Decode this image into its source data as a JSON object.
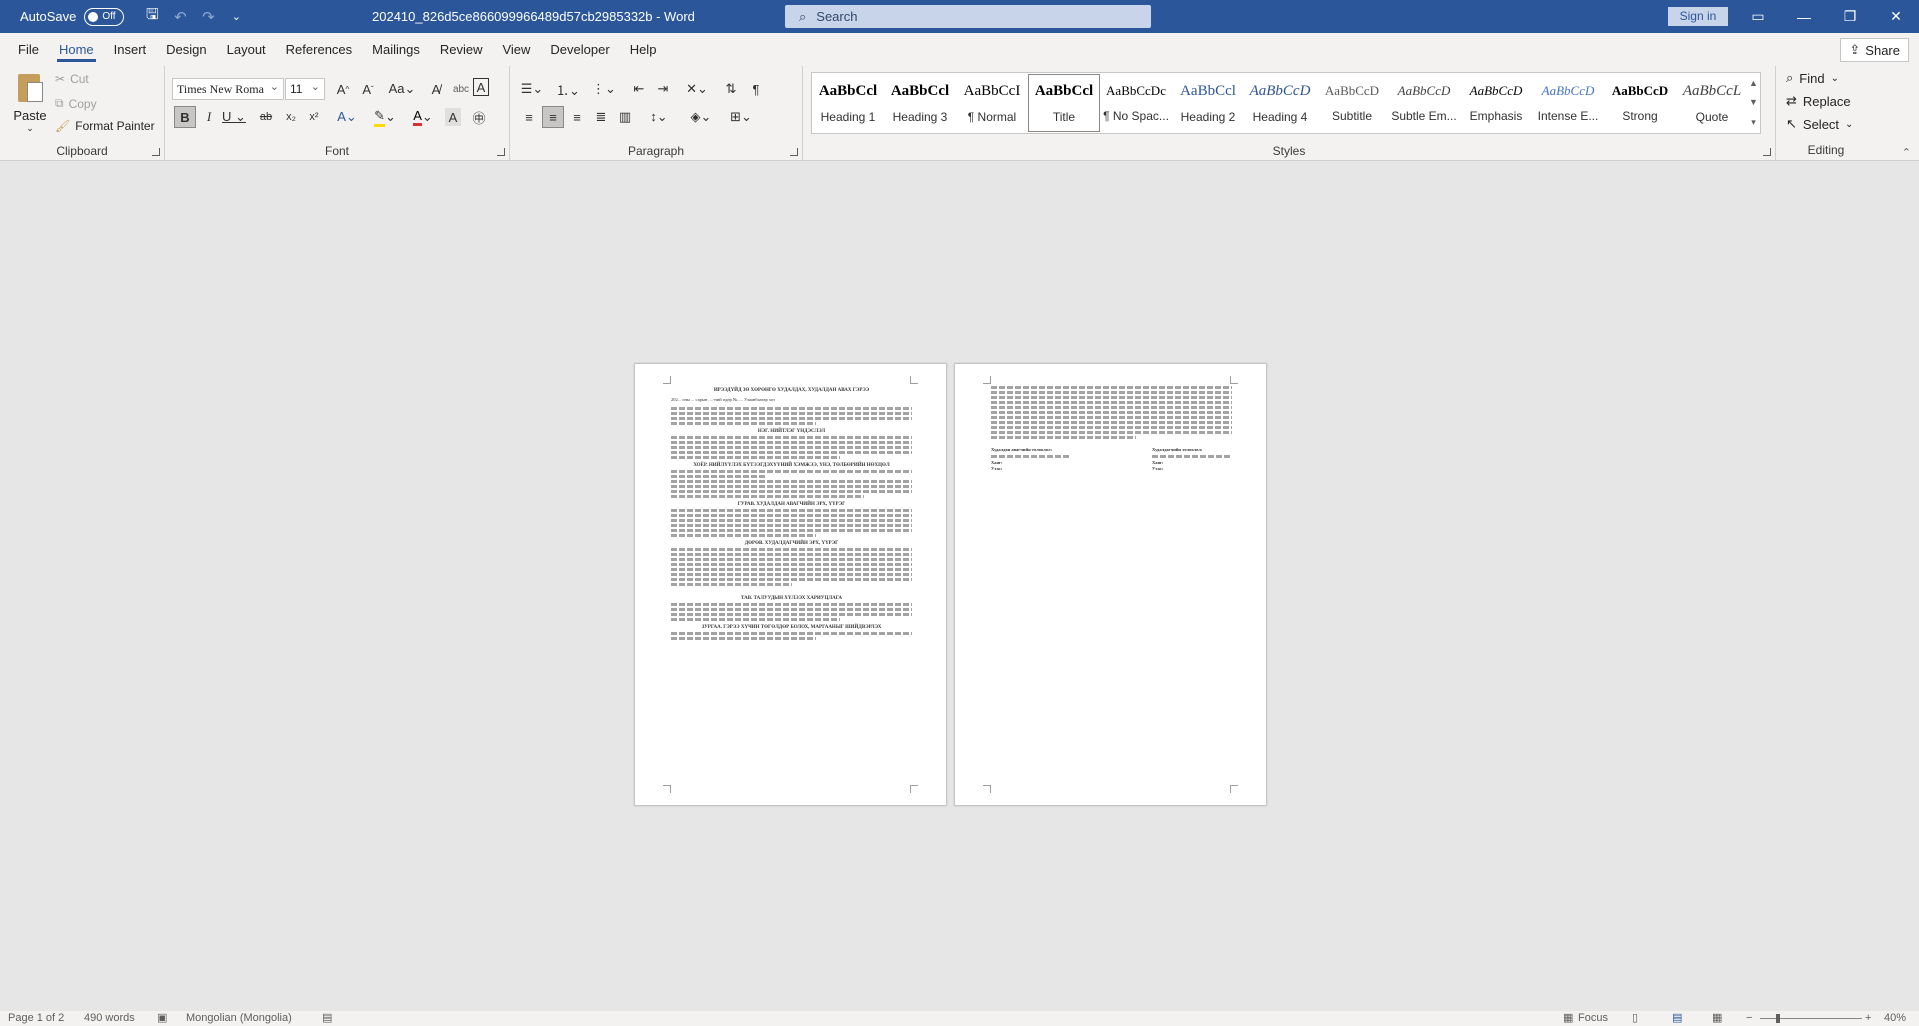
{
  "titlebar": {
    "autosave_label": "AutoSave",
    "autosave_state": "Off",
    "document_title": "202410_826d5ce866099966489d57cb2985332b  -  Word",
    "search_placeholder": "Search",
    "signin_label": "Sign in"
  },
  "tabs": [
    "File",
    "Home",
    "Insert",
    "Design",
    "Layout",
    "References",
    "Mailings",
    "Review",
    "View",
    "Developer",
    "Help"
  ],
  "active_tab": "Home",
  "share_label": "Share",
  "clipboard": {
    "label": "Clipboard",
    "paste": "Paste",
    "cut": "Cut",
    "copy": "Copy",
    "format_painter": "Format Painter"
  },
  "font": {
    "label": "Font",
    "name": "Times New Roma",
    "size": "11"
  },
  "paragraph": {
    "label": "Paragraph"
  },
  "styles": {
    "label": "Styles",
    "items": [
      {
        "sample": "AaBbCcl",
        "name": "Heading 1"
      },
      {
        "sample": "AaBbCcl",
        "name": "Heading 3"
      },
      {
        "sample": "AaBbCcI",
        "name": "¶ Normal"
      },
      {
        "sample": "AaBbCcl",
        "name": "Title"
      },
      {
        "sample": "AaBbCcDc",
        "name": "¶ No Spac..."
      },
      {
        "sample": "AaBbCcl",
        "name": "Heading 2"
      },
      {
        "sample": "AaBbCcD",
        "name": "Heading 4"
      },
      {
        "sample": "AaBbCcD",
        "name": "Subtitle"
      },
      {
        "sample": "AaBbCcD",
        "name": "Subtle Em..."
      },
      {
        "sample": "AaBbCcD",
        "name": "Emphasis"
      },
      {
        "sample": "AaBbCcD",
        "name": "Intense E..."
      },
      {
        "sample": "AaBbCcD",
        "name": "Strong"
      },
      {
        "sample": "AaBbCcL",
        "name": "Quote"
      }
    ]
  },
  "editing": {
    "label": "Editing",
    "find": "Find",
    "replace": "Replace",
    "select": "Select"
  },
  "page1": {
    "title": "ИРЭЭДҮЙД ЗӨ ХӨРӨНГӨ ХУДАЛДАХ, ХУДАЛДАН АВАХ ГЭРЭЭ",
    "dateline": "202... оны ... сарын ....-ний өдөр                    №.....                    Улаанбаатар хот",
    "sections": [
      "НЭГ. НИЙТЛЭГ ҮНДЭСЛЭЛ",
      "ХОЁР. НИЙЛҮҮЛЭХ БҮТЭЭГДЭХҮҮНИЙ ХЭМЖЭЭ, ҮНЭ, ТӨЛБӨРИЙН НӨХЦӨЛ",
      "ГУРАВ. ХУДАЛДАН АВАГЧИЙН ЭРХ, ҮҮРЭГ",
      "ДӨРӨВ. ХУДАЛДАГЧИЙН ЭРХ, ҮҮРЭГ",
      "ТАВ. ТАЛУУДЫН ХҮЛЭЭХ ХАРИУЦЛАГА",
      "ЗУРГАА. ГЭРЭЭ ХҮЧИН ТӨГӨЛДӨР БОЛОХ, МАРГААНЫГ ШИЙДВЭРЛЭХ"
    ]
  },
  "page2": {
    "seller": "Худалдан авагчийн төлөөлөл:",
    "buyer": "Худалдагчийн төлөөлөл:",
    "addr": "Хаяг:",
    "phone": "Утас:"
  },
  "status": {
    "page": "Page 1 of 2",
    "words": "490 words",
    "language": "Mongolian (Mongolia)",
    "focus": "Focus",
    "zoom": "40%"
  },
  "colors": {
    "accent": "#2b579a",
    "ribbon_bg": "#f3f2f1",
    "canvas_bg": "#e6e6e6"
  }
}
